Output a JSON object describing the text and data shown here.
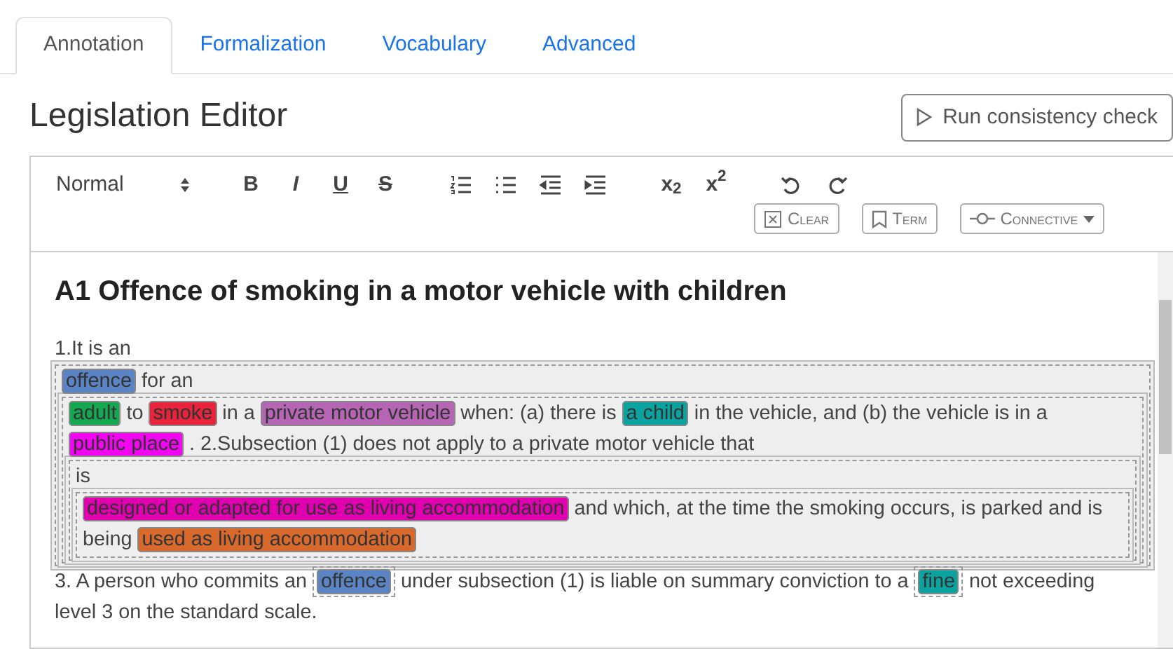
{
  "tabs": [
    {
      "label": "Annotation",
      "selected": true
    },
    {
      "label": "Formalization",
      "selected": false
    },
    {
      "label": "Vocabulary",
      "selected": false
    },
    {
      "label": "Advanced",
      "selected": false
    }
  ],
  "title": "Legislation Editor",
  "run_button": {
    "label": "Run consistency check"
  },
  "toolbar": {
    "groups": [
      [
        {
          "kind": "select",
          "label": "Normal"
        }
      ],
      [
        {
          "kind": "bold",
          "label": "B"
        },
        {
          "kind": "italic",
          "label": "I"
        },
        {
          "kind": "underline",
          "label": "U"
        },
        {
          "kind": "strike",
          "label": "S"
        }
      ],
      [
        {
          "kind": "ordered-list"
        },
        {
          "kind": "bullet-list"
        },
        {
          "kind": "outdent"
        },
        {
          "kind": "indent"
        }
      ],
      [
        {
          "kind": "script",
          "label": "x$_{2}$"
        },
        {
          "kind": "script",
          "label": "x$^{2}$"
        }
      ],
      [
        {
          "kind": "undo"
        },
        {
          "kind": "redo"
        }
      ]
    ],
    "annotation_buttons": [
      {
        "kind": "clear",
        "label": "Clear"
      },
      {
        "kind": "term",
        "label": "Term"
      },
      {
        "kind": "connective",
        "label": "Connective"
      }
    ]
  },
  "document": {
    "heading": "A1 Offence of smoking in a motor vehicle with children",
    "blocks": [
      {
        "kind": "text",
        "text": "1.It is an"
      },
      {
        "kind": "group",
        "children": [
          {
            "kind": "term",
            "text": "offence",
            "color": "#5b84c4"
          },
          {
            "kind": "text",
            "text": "for an"
          },
          {
            "kind": "group",
            "children": [
              {
                "kind": "term",
                "text": "adult",
                "color": "#14a850"
              },
              {
                "kind": "text",
                "text": "to"
              },
              {
                "kind": "term",
                "text": "smoke",
                "color": "#e8233b"
              },
              {
                "kind": "text",
                "text": "in a"
              },
              {
                "kind": "term",
                "text": "private motor vehicle",
                "color": "#b565b3"
              },
              {
                "kind": "text",
                "text": "when: (a) there is"
              },
              {
                "kind": "term",
                "text": "a child",
                "color": "#0aa3a0"
              },
              {
                "kind": "text",
                "text": "in the vehicle, and (b) the vehicle is in a"
              },
              {
                "kind": "term",
                "text": "public place",
                "color": "#f205f0"
              },
              {
                "kind": "text",
                "text": ". 2.Subsection (1) does not apply to a private motor vehicle that"
              },
              {
                "kind": "group",
                "children": [
                  {
                    "kind": "text",
                    "text": "is"
                  },
                  {
                    "kind": "group",
                    "children": [
                      {
                        "kind": "term",
                        "text": "designed or adapted for use as living accommodation",
                        "color": "#e000b0"
                      },
                      {
                        "kind": "text",
                        "text": "and which, at the time the smoking occurs, is parked and is"
                      },
                      {
                        "kind": "text",
                        "text": "being"
                      },
                      {
                        "kind": "term",
                        "text": "used as living accommodation",
                        "color": "#d8692d"
                      }
                    ]
                  }
                ]
              }
            ]
          }
        ]
      },
      {
        "kind": "text",
        "text": "3. A person who commits an"
      },
      {
        "kind": "inline-group",
        "children": [
          {
            "kind": "term",
            "text": "offence",
            "color": "#5b84c4"
          }
        ]
      },
      {
        "kind": "text",
        "text": "under subsection (1) is liable on summary conviction to a"
      },
      {
        "kind": "inline-group",
        "children": [
          {
            "kind": "term",
            "text": "fine",
            "color": "#0aa3a0"
          }
        ]
      },
      {
        "kind": "text",
        "text": "not exceeding"
      },
      {
        "kind": "text",
        "text": "level 3 on the standard scale."
      }
    ]
  }
}
